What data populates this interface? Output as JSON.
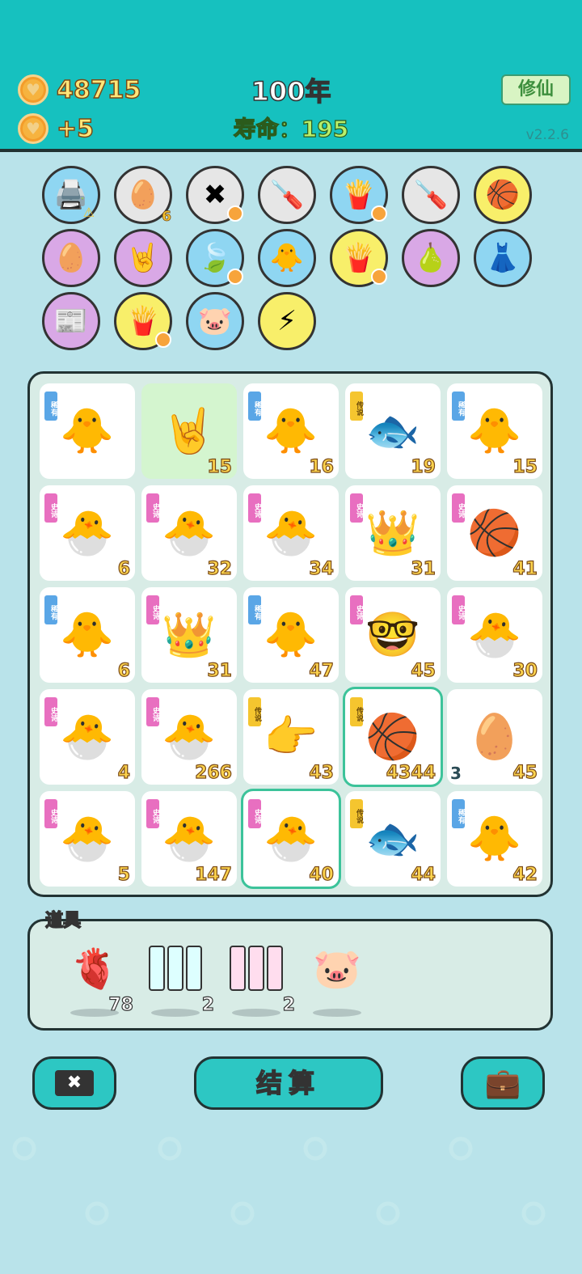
{
  "header": {
    "coins": "48715",
    "income": "+5",
    "year": "100年",
    "lifespan": "寿命：195",
    "xiuxian_label": "修仙",
    "version": "v2.2.6"
  },
  "icons": {
    "row1": [
      {
        "emoji": "🖨️",
        "bg": "#8fd6f2",
        "name": "printer-icon",
        "count": "",
        "warn": true,
        "badge": false
      },
      {
        "emoji": "🥚",
        "bg": "#e6e6e6",
        "name": "egg-tray-icon",
        "count": "6",
        "warn": false,
        "badge": false
      },
      {
        "emoji": "✖",
        "bg": "#e6e6e6",
        "name": "delete-tag-icon",
        "count": "",
        "warn": false,
        "badge": true
      },
      {
        "emoji": "🪛",
        "bg": "#e6e6e6",
        "name": "screwdriver-icon",
        "count": "",
        "warn": false,
        "badge": false
      },
      {
        "emoji": "🍟",
        "bg": "#8fd6f2",
        "name": "fries-icon",
        "count": "",
        "warn": false,
        "badge": true
      },
      {
        "emoji": "🪛",
        "bg": "#e6e6e6",
        "name": "screwdriver-icon",
        "count": "",
        "warn": false,
        "badge": false
      },
      {
        "emoji": "🏀",
        "bg": "#f8ef6a",
        "name": "basketballs-icon",
        "count": "",
        "warn": false,
        "badge": false
      }
    ],
    "row2": [
      {
        "emoji": "🥚",
        "bg": "#d9a8e6",
        "name": "egg-face-icon",
        "count": "",
        "warn": false,
        "badge": false
      },
      {
        "emoji": "🤘",
        "bg": "#d9a8e6",
        "name": "rock-hand-icon",
        "count": "",
        "warn": false,
        "badge": false
      },
      {
        "emoji": "🍃",
        "bg": "#8fd6f2",
        "name": "leaf-icon",
        "count": "",
        "warn": false,
        "badge": true
      },
      {
        "emoji": "🐥",
        "bg": "#8fd6f2",
        "name": "chick-egg-icon",
        "count": "",
        "warn": false,
        "badge": false
      },
      {
        "emoji": "🍟",
        "bg": "#f8ef6a",
        "name": "fries-icon",
        "count": "",
        "warn": false,
        "badge": true
      },
      {
        "emoji": "🍐",
        "bg": "#d9a8e6",
        "name": "pomelo-icon",
        "count": "",
        "warn": false,
        "badge": false
      },
      {
        "emoji": "👗",
        "bg": "#8fd6f2",
        "name": "skirt-icon",
        "count": "",
        "warn": false,
        "badge": false
      }
    ],
    "row3": [
      {
        "emoji": "📰",
        "bg": "#d9a8e6",
        "name": "time-magazine-icon",
        "count": "",
        "warn": false,
        "badge": false
      },
      {
        "emoji": "🍟",
        "bg": "#f8ef6a",
        "name": "fries-icon",
        "count": "",
        "warn": false,
        "badge": true
      },
      {
        "emoji": "🐷",
        "bg": "#8fd6f2",
        "name": "piggy-bank-icon",
        "count": "",
        "warn": false,
        "badge": false
      },
      {
        "emoji": "⚡",
        "bg": "#f8ef6a",
        "name": "lightning-icon",
        "count": "",
        "warn": false,
        "badge": false
      }
    ]
  },
  "board": [
    {
      "e": "🐥",
      "tag": "稀有",
      "t": "blue",
      "n": "",
      "name": "chick"
    },
    {
      "e": "🤘",
      "tag": "",
      "t": "",
      "n": "15",
      "name": "rock-hand",
      "green": true
    },
    {
      "e": "🐥",
      "tag": "稀有",
      "t": "blue",
      "n": "16",
      "name": "chick"
    },
    {
      "e": "🐟",
      "tag": "传说",
      "t": "yellow",
      "n": "19",
      "name": "koi"
    },
    {
      "e": "🐥",
      "tag": "稀有",
      "t": "blue",
      "n": "15",
      "name": "chick-professor"
    },
    {
      "e": "🐣",
      "tag": "史诗",
      "t": "pink",
      "n": "6",
      "name": "professor-chick"
    },
    {
      "e": "🐣",
      "tag": "史诗",
      "t": "pink",
      "n": "32",
      "name": "professor-chick"
    },
    {
      "e": "🐣",
      "tag": "史诗",
      "t": "pink",
      "n": "34",
      "name": "professor-chick"
    },
    {
      "e": "👑",
      "tag": "史诗",
      "t": "pink",
      "n": "31",
      "name": "king-chick"
    },
    {
      "e": "🏀",
      "tag": "史诗",
      "t": "pink",
      "n": "41",
      "name": "basketball"
    },
    {
      "e": "🐥",
      "tag": "稀有",
      "t": "blue",
      "n": "6",
      "name": "chick"
    },
    {
      "e": "👑",
      "tag": "史诗",
      "t": "pink",
      "n": "31",
      "name": "king-chick"
    },
    {
      "e": "🐥",
      "tag": "稀有",
      "t": "blue",
      "n": "47",
      "name": "chick"
    },
    {
      "e": "🤓",
      "tag": "史诗",
      "t": "pink",
      "n": "45",
      "name": "old-man-basketball"
    },
    {
      "e": "🐣",
      "tag": "史诗",
      "t": "pink",
      "n": "30",
      "name": "professor-chick"
    },
    {
      "e": "🐣",
      "tag": "史诗",
      "t": "pink",
      "n": "4",
      "name": "professor-chick"
    },
    {
      "e": "🐣",
      "tag": "史诗",
      "t": "pink",
      "n": "266",
      "name": "professor-chick"
    },
    {
      "e": "👉",
      "tag": "传说",
      "t": "yellow",
      "n": "43",
      "name": "pointing-hand"
    },
    {
      "e": "🏀",
      "tag": "传说",
      "t": "yellow",
      "n": "4344",
      "name": "basketball",
      "sel": true
    },
    {
      "e": "🥚",
      "tag": "",
      "t": "",
      "n": "45",
      "name": "egg",
      "side": "3"
    },
    {
      "e": "🐣",
      "tag": "史诗",
      "t": "pink",
      "n": "5",
      "name": "professor-chick"
    },
    {
      "e": "🐣",
      "tag": "史诗",
      "t": "pink",
      "n": "147",
      "name": "professor-chick"
    },
    {
      "e": "🐣",
      "tag": "史诗",
      "t": "pink",
      "n": "40",
      "name": "professor-chick",
      "sel": true
    },
    {
      "e": "🐟",
      "tag": "传说",
      "t": "yellow",
      "n": "44",
      "name": "koi"
    },
    {
      "e": "🐥",
      "tag": "稀有",
      "t": "blue",
      "n": "42",
      "name": "chick"
    }
  ],
  "tools": {
    "label": "道具",
    "items": [
      {
        "kind": "liver",
        "emoji": "🫀",
        "count": "78"
      },
      {
        "kind": "scroll-rare",
        "count": "2"
      },
      {
        "kind": "scroll-epic",
        "count": "2"
      },
      {
        "kind": "piggy",
        "emoji": "🐷",
        "count": ""
      }
    ]
  },
  "buttons": {
    "delete_label": "✖",
    "settle_label": "结算",
    "bag_icon": "💼"
  }
}
